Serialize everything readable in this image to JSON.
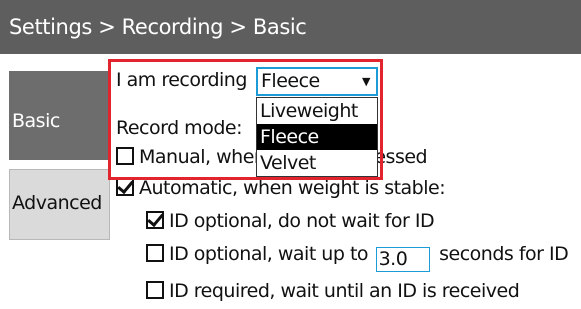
{
  "header": {
    "title": "Settings > Recording > Basic"
  },
  "tabs": [
    {
      "label": "Basic"
    },
    {
      "label": "Advanced"
    }
  ],
  "form": {
    "recording_label": "I am recording",
    "recording_select": {
      "value": "Fleece",
      "options": [
        "Liveweight",
        "Fleece",
        "Velvet"
      ],
      "highlighted": "Fleece"
    },
    "record_mode_label": "Record mode:",
    "manual_label": "Manual, when button is pressed",
    "manual_checked": false,
    "automatic_label": "Automatic, when weight is stable:",
    "automatic_checked": true,
    "id_options": [
      {
        "label": "ID optional, do not wait for ID",
        "checked": true
      },
      {
        "prefix": "ID optional, wait up to",
        "value": "3.0",
        "suffix": "seconds for ID",
        "checked": false
      },
      {
        "label": "ID required, wait until an ID is received",
        "checked": false
      }
    ]
  },
  "colors": {
    "titlebar": "#5e5e5e",
    "highlight_border": "#e2242f",
    "input_border": "#1c9bd6"
  }
}
